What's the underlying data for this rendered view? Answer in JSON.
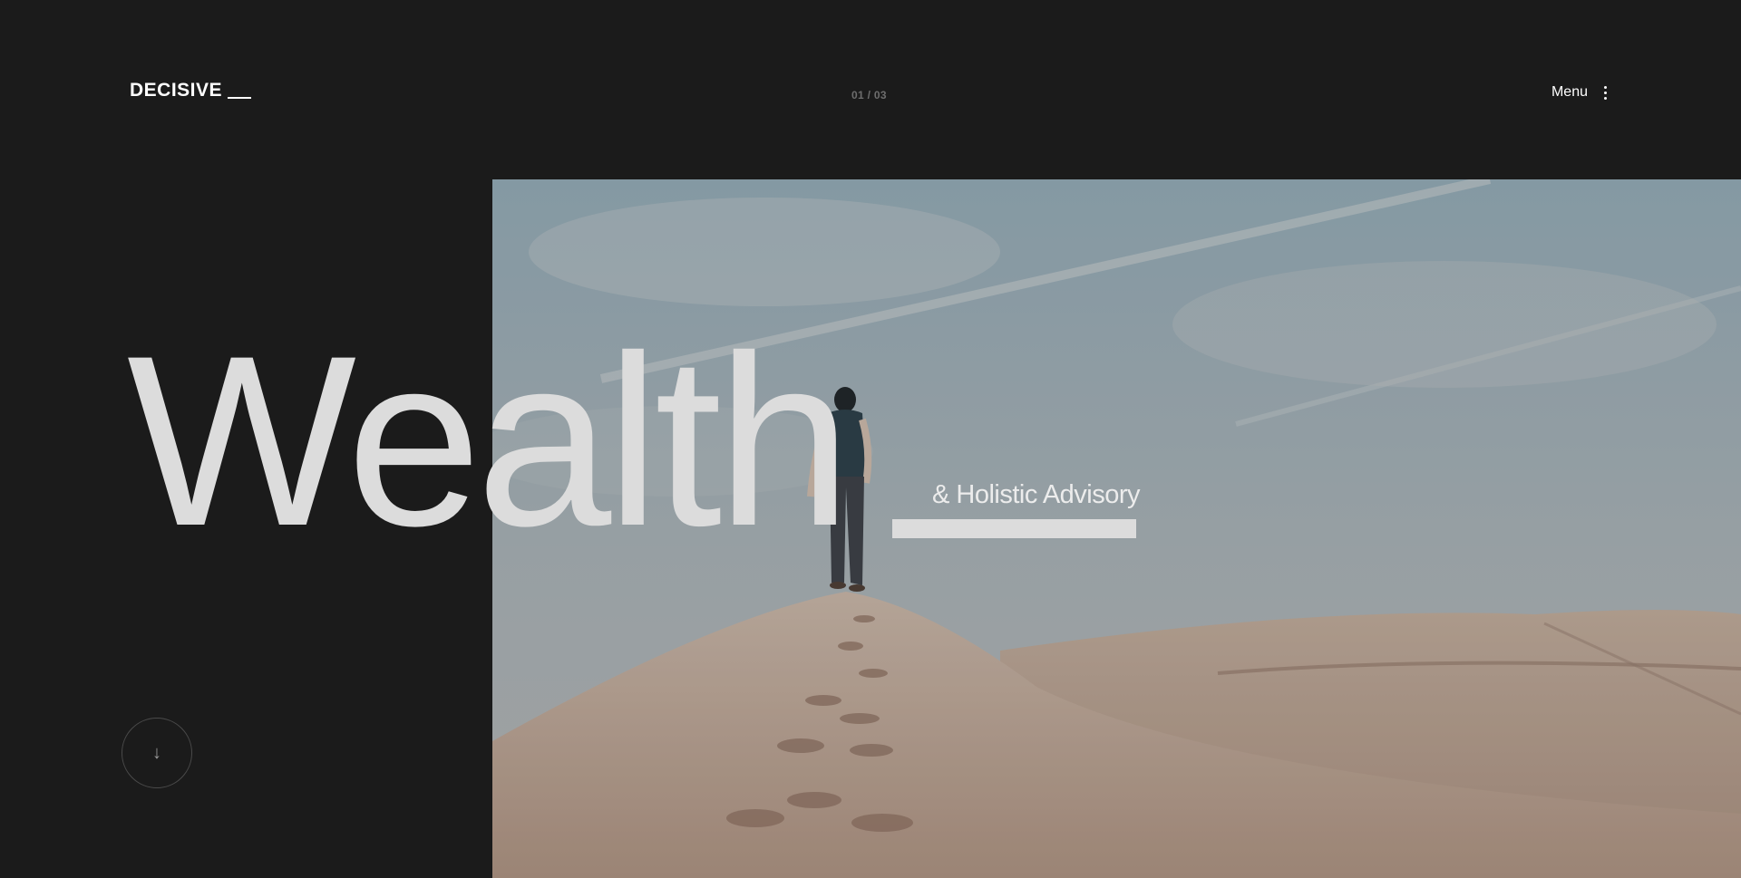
{
  "header": {
    "logo_text": "DECISIVE",
    "slide_counter": "01 / 03",
    "menu_label": "Menu"
  },
  "hero": {
    "headline": "Wealth",
    "subheadline": "& Holistic Advisory",
    "image_alt": "Person walking on a desert sand dune ridge"
  },
  "scroll": {
    "icon": "arrow-down-icon",
    "glyph": "↓"
  },
  "colors": {
    "background": "#1b1b1b",
    "headline": "#dcdcdc",
    "accent_text": "#ffffff",
    "muted": "#6d6d6d"
  }
}
